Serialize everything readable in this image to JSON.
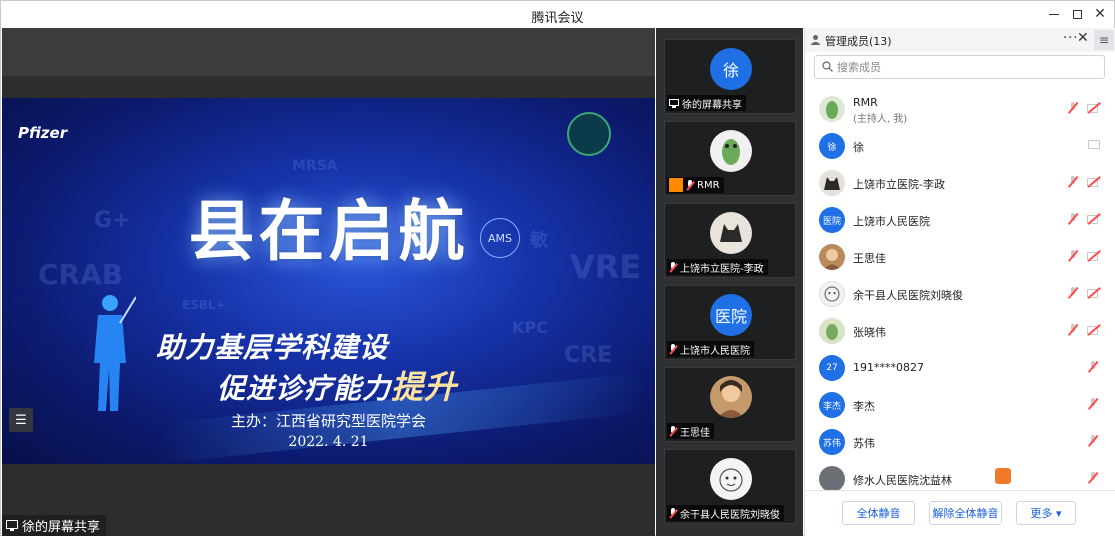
{
  "window": {
    "title": "腾讯会议"
  },
  "stage": {
    "slide": {
      "logo": "Pfizer",
      "headline": "县在启航",
      "subtitle_line1": "助力基层学科建设",
      "subtitle_line2_a": "促进诊疗能力",
      "subtitle_line2_b": "提升",
      "organizer": "主办：江西省研究型医院学会",
      "date": "2022. 4. 21",
      "background_words": [
        "CRAB",
        "G+",
        "MRSA",
        "ESBL+",
        "VRE",
        "KPC",
        "CRE",
        "AMS",
        "敏"
      ]
    },
    "share_label": "徐的屏幕共享"
  },
  "tiles": [
    {
      "label": "徐的屏幕共享",
      "avatar_text": "徐",
      "avatar_color": "#1f6fe5",
      "icon": "screen-share-icon"
    },
    {
      "label": "RMR",
      "avatar_text": "",
      "avatar_color": "#f0f0f0",
      "icon": "host-icon"
    },
    {
      "label": "上饶市立医院-李政",
      "avatar_text": "",
      "avatar_color": "#e8e4dc",
      "icon": "mic-muted-icon"
    },
    {
      "label": "上饶市人民医院",
      "avatar_text": "医院",
      "avatar_color": "#1f6fe5",
      "icon": "mic-muted-icon"
    },
    {
      "label": "王思佳",
      "avatar_text": "",
      "avatar_color": "#c59a6a",
      "icon": "mic-muted-icon"
    },
    {
      "label": "余干县人民医院刘晓俊",
      "avatar_text": "",
      "avatar_color": "#f4f4f4",
      "icon": "mic-muted-icon"
    }
  ],
  "panel": {
    "title": "管理成员(13)",
    "more": "···",
    "search_placeholder": "搜索成员",
    "members": [
      {
        "name": "RMR",
        "sub": "(主持人, 我)",
        "avatar_text": "",
        "avatar_color": "#dfe8d4",
        "mic": "muted",
        "cam": "off"
      },
      {
        "name": "徐",
        "sub": "",
        "avatar_text": "徐",
        "avatar_color": "#1f6fe5",
        "mic": "none",
        "cam": "screen"
      },
      {
        "name": "上饶市立医院-李政",
        "sub": "",
        "avatar_text": "",
        "avatar_color": "#e6e2da",
        "mic": "muted",
        "cam": "off"
      },
      {
        "name": "上饶市人民医院",
        "sub": "",
        "avatar_text": "医院",
        "avatar_color": "#1f6fe5",
        "mic": "muted",
        "cam": "off"
      },
      {
        "name": "王思佳",
        "sub": "",
        "avatar_text": "",
        "avatar_color": "#b98a5c",
        "mic": "muted",
        "cam": "off"
      },
      {
        "name": "余干县人民医院刘晓俊",
        "sub": "",
        "avatar_text": "",
        "avatar_color": "#f2f2f2",
        "mic": "muted",
        "cam": "off"
      },
      {
        "name": "张晓伟",
        "sub": "",
        "avatar_text": "",
        "avatar_color": "#d9e4c6",
        "mic": "muted",
        "cam": "off"
      },
      {
        "name": "191****0827",
        "sub": "",
        "avatar_text": "27",
        "avatar_color": "#1f6fe5",
        "mic": "muted",
        "cam": "none"
      },
      {
        "name": "李杰",
        "sub": "",
        "avatar_text": "李杰",
        "avatar_color": "#1f6fe5",
        "mic": "muted",
        "cam": "none"
      },
      {
        "name": "苏伟",
        "sub": "",
        "avatar_text": "苏伟",
        "avatar_color": "#1f6fe5",
        "mic": "muted",
        "cam": "none"
      },
      {
        "name": "修水人民医院沈益林",
        "sub": "",
        "avatar_text": "",
        "avatar_color": "#6a6f78",
        "mic": "muted",
        "cam": "none"
      }
    ],
    "buttons": {
      "mute_all": "全体静音",
      "unmute_all": "解除全体静音",
      "more": "更多 ▾"
    }
  }
}
